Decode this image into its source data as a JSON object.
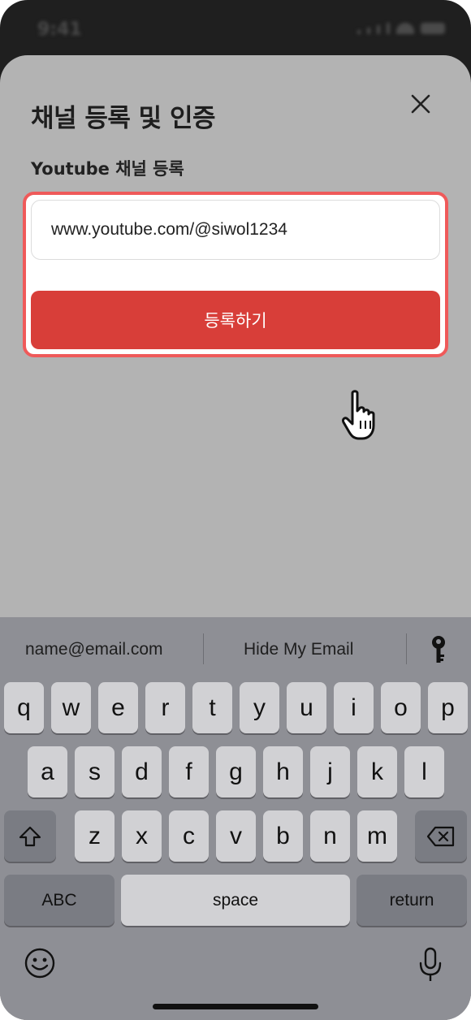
{
  "status_bar": {
    "time": "9:41"
  },
  "sheet": {
    "title": "채널 등록 및 인증",
    "subtitle": "Youtube 채널 등록",
    "url_input_value": "www.youtube.com/@siwol1234",
    "register_button": "등록하기"
  },
  "colors": {
    "accent": "#d83e39",
    "highlight_border": "#ef5a5a",
    "sheet_bg": "#b3b3b3",
    "keyboard_bg": "#8e8f95"
  },
  "keyboard": {
    "suggestions": [
      "name@email.com",
      "Hide My Email"
    ],
    "suggestion_icon": "key-icon",
    "row1": [
      "q",
      "w",
      "e",
      "r",
      "t",
      "y",
      "u",
      "i",
      "o",
      "p"
    ],
    "row2": [
      "a",
      "s",
      "d",
      "f",
      "g",
      "h",
      "j",
      "k",
      "l"
    ],
    "row3": [
      "z",
      "x",
      "c",
      "v",
      "b",
      "n",
      "m"
    ],
    "shift_icon": "shift-icon",
    "delete_icon": "delete-icon",
    "abc_label": "ABC",
    "space_label": "space",
    "return_label": "return",
    "emoji_icon": "emoji-icon",
    "mic_icon": "mic-icon"
  }
}
